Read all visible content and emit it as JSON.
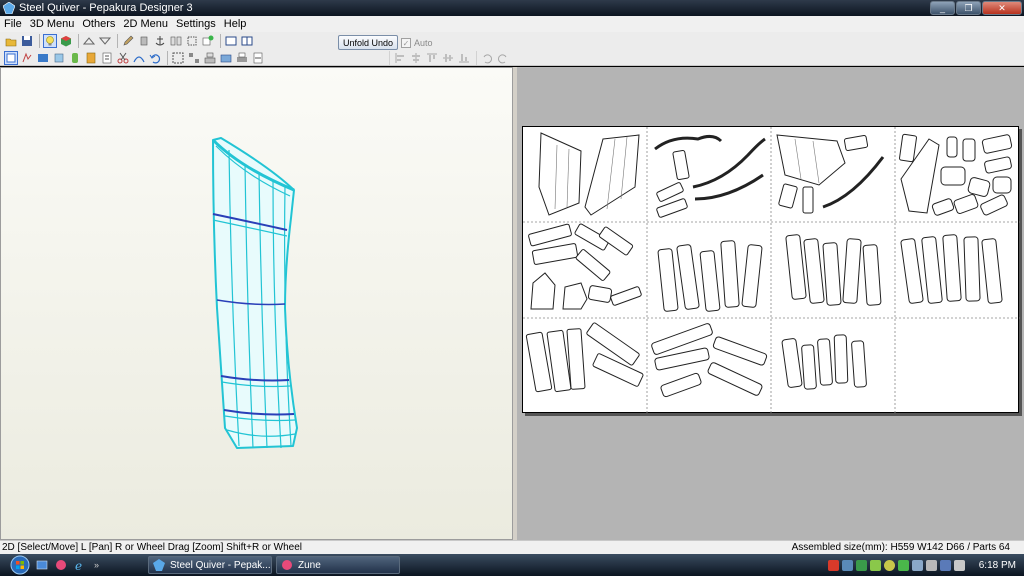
{
  "window": {
    "title": "Steel Quiver - Pepakura Designer 3",
    "minimize": "_",
    "maximize": "❐",
    "close": "✕"
  },
  "menu": [
    "File",
    "3D Menu",
    "Others",
    "2D Menu",
    "Settings",
    "Help"
  ],
  "toolbar": {
    "unfold_undo_label": "Unfold Undo",
    "auto_label": "Auto",
    "auto_checked": "✓"
  },
  "status": {
    "hint": "2D [Select/Move] L [Pan] R or Wheel Drag [Zoom] Shift+R or Wheel",
    "assembled": "Assembled size(mm): H559 W142 D66 / Parts 64"
  },
  "taskbar": {
    "tasks": [
      {
        "label": "Steel Quiver - Pepak..."
      },
      {
        "label": "Zune"
      }
    ],
    "clock": "6:18 PM",
    "quicklaunch_more": "»"
  },
  "colors": {
    "mesh": "#22c4d4",
    "mesh_band": "#2a3fb8",
    "accent": "#3a6fd0"
  }
}
